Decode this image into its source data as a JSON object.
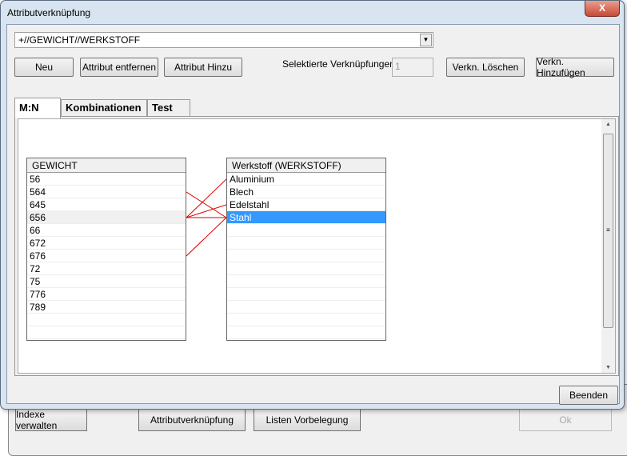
{
  "window": {
    "title": "Attributverknüpfung",
    "close": "X"
  },
  "combo": {
    "value": "+//GEWICHT//WERKSTOFF"
  },
  "toolbar": {
    "neu": "Neu",
    "remove": "Attribut entfernen",
    "add": "Attribut Hinzu",
    "selected_label": "Selektierte Verknüpfungen:",
    "selected_count": "1",
    "delete_link": "Verkn. Löschen",
    "add_link": "Verkn. Hinzufügen"
  },
  "tabs": [
    {
      "label": "M:N"
    },
    {
      "label": "Kombinationen"
    },
    {
      "label": "Test"
    }
  ],
  "left_list": {
    "header": "GEWICHT",
    "items": [
      "56",
      "564",
      "645",
      "656",
      "66",
      "672",
      "676",
      "72",
      "75",
      "776",
      "789"
    ]
  },
  "right_list": {
    "header": "Werkstoff (WERKSTOFF)",
    "items": [
      "Aluminium",
      "Blech",
      "Edelstahl",
      "Stahl"
    ],
    "selected": "Stahl"
  },
  "links": [
    [
      "564",
      "Stahl"
    ],
    [
      "656",
      "Aluminium"
    ],
    [
      "656",
      "Edelstahl"
    ],
    [
      "656",
      "Stahl"
    ],
    [
      "676",
      "Stahl"
    ]
  ],
  "footer": {
    "close": "Beenden"
  },
  "parent": {
    "b1": "Indexe verwalten",
    "b2": "Attributverknüpfung",
    "b3": "Listen Vorbelegung",
    "ok": "Ok"
  }
}
